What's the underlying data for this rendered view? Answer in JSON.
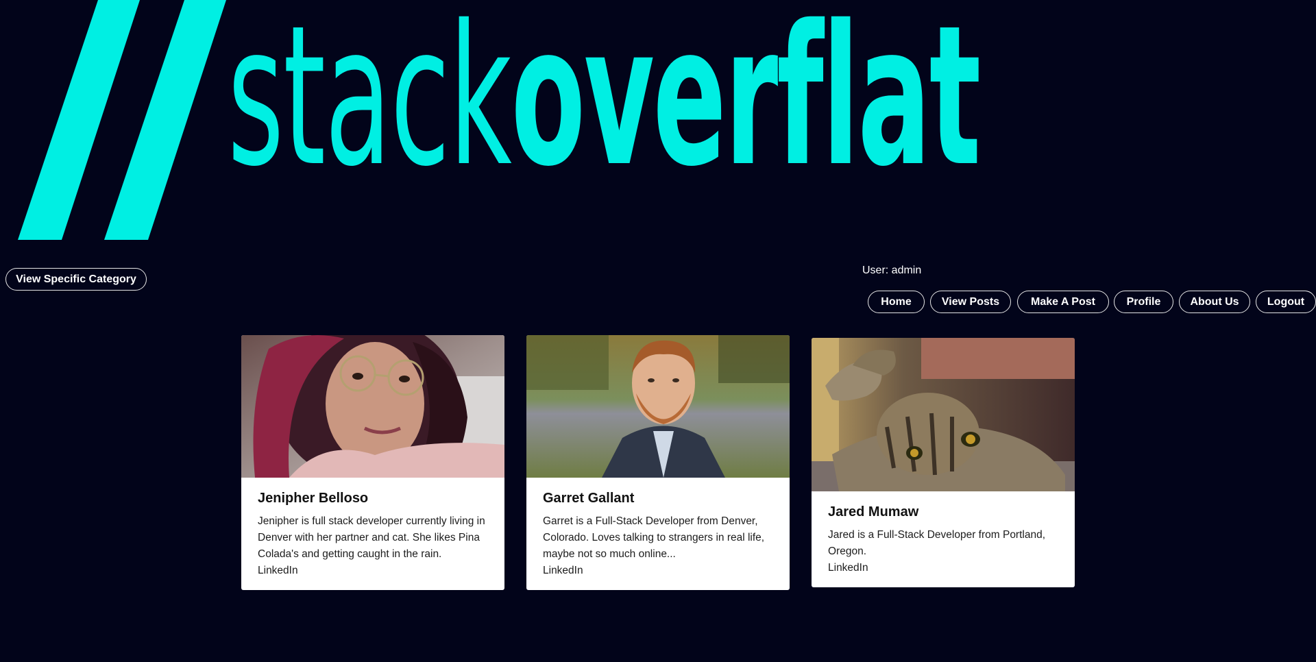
{
  "brand": {
    "name_light": "stack",
    "name_bold": "overflat",
    "color": "#00efe3"
  },
  "category_button": "View Specific Category",
  "user": {
    "label": "User: admin"
  },
  "nav": [
    "Home",
    "View Posts",
    "Make A Post",
    "Profile",
    "About Us",
    "Logout"
  ],
  "team": [
    {
      "name": "Jenipher Belloso",
      "bio": "Jenipher is full stack developer currently living in Denver with her partner and cat. She likes Pina Colada's and getting caught in the rain.",
      "link": "LinkedIn",
      "photo": "portrait-woman-glasses-pink-hair"
    },
    {
      "name": "Garret Gallant",
      "bio": "Garret is a Full-Stack Developer from Denver, Colorado. Loves talking to strangers in real life, maybe not so much online...",
      "link": "LinkedIn",
      "photo": "portrait-bearded-man-suit"
    },
    {
      "name": "Jared Mumaw",
      "bio": "Jared is a Full-Stack Developer from Portland, Oregon.",
      "link": "LinkedIn",
      "photo": "tabby-cat-lying"
    }
  ],
  "colors": {
    "background": "#02041a",
    "accent": "#00efe3",
    "card": "#ffffff",
    "text": "#1c1c1c"
  }
}
